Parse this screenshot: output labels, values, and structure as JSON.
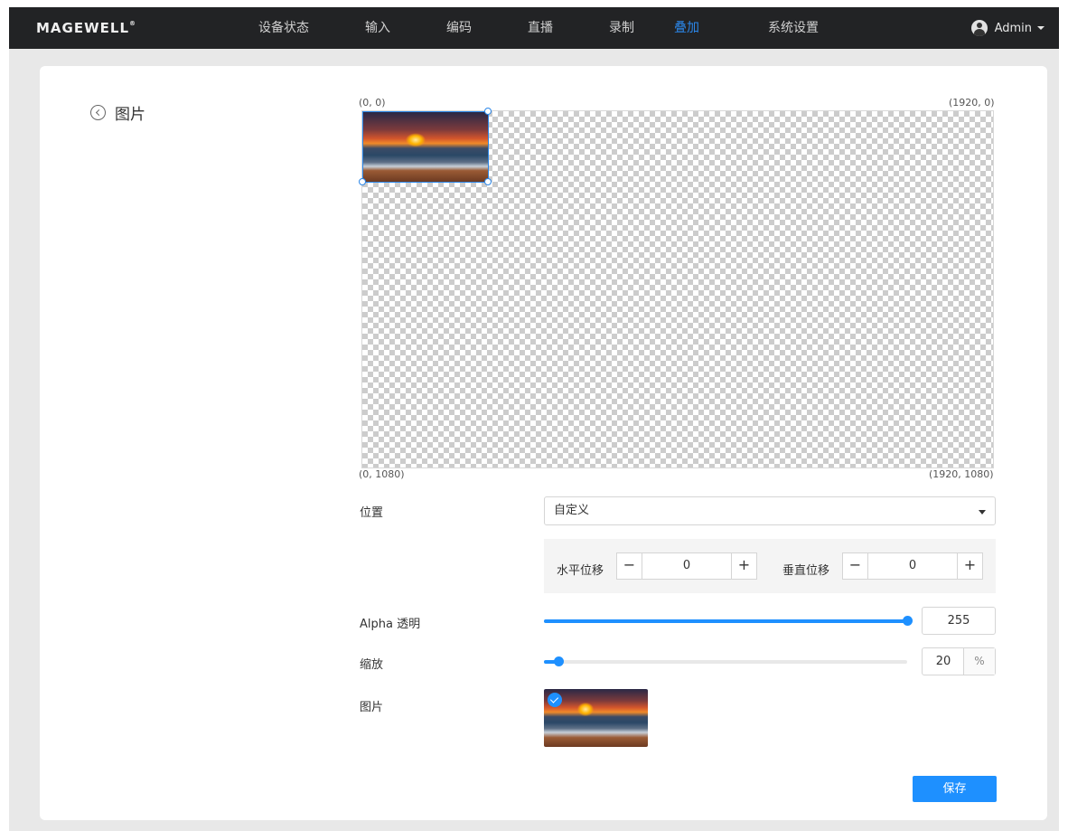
{
  "header": {
    "logo": "MAGEWELL",
    "logo_mark": "®",
    "nav": [
      "设备状态",
      "输入",
      "编码",
      "直播",
      "录制",
      "叠加",
      "系统设置"
    ],
    "active_nav": "叠加",
    "user": "Admin"
  },
  "page": {
    "title": "图片"
  },
  "canvas": {
    "top_left": "(0, 0)",
    "top_right": "(1920, 0)",
    "bottom_left": "(0, 1080)",
    "bottom_right": "(1920, 1080)"
  },
  "form": {
    "position_label": "位置",
    "position_value": "自定义",
    "h_offset_label": "水平位移",
    "h_offset_value": "0",
    "v_offset_label": "垂直位移",
    "v_offset_value": "0",
    "minus": "−",
    "plus": "+",
    "alpha_label": "Alpha 透明",
    "alpha_value": "255",
    "alpha_fraction": 1.0,
    "scale_label": "缩放",
    "scale_value": "20",
    "scale_unit": "%",
    "scale_fraction": 0.04,
    "image_label": "图片",
    "save_label": "保存"
  },
  "colors": {
    "accent": "#1e90ff",
    "active_nav": "#2b86e8",
    "topbar": "#222325"
  }
}
